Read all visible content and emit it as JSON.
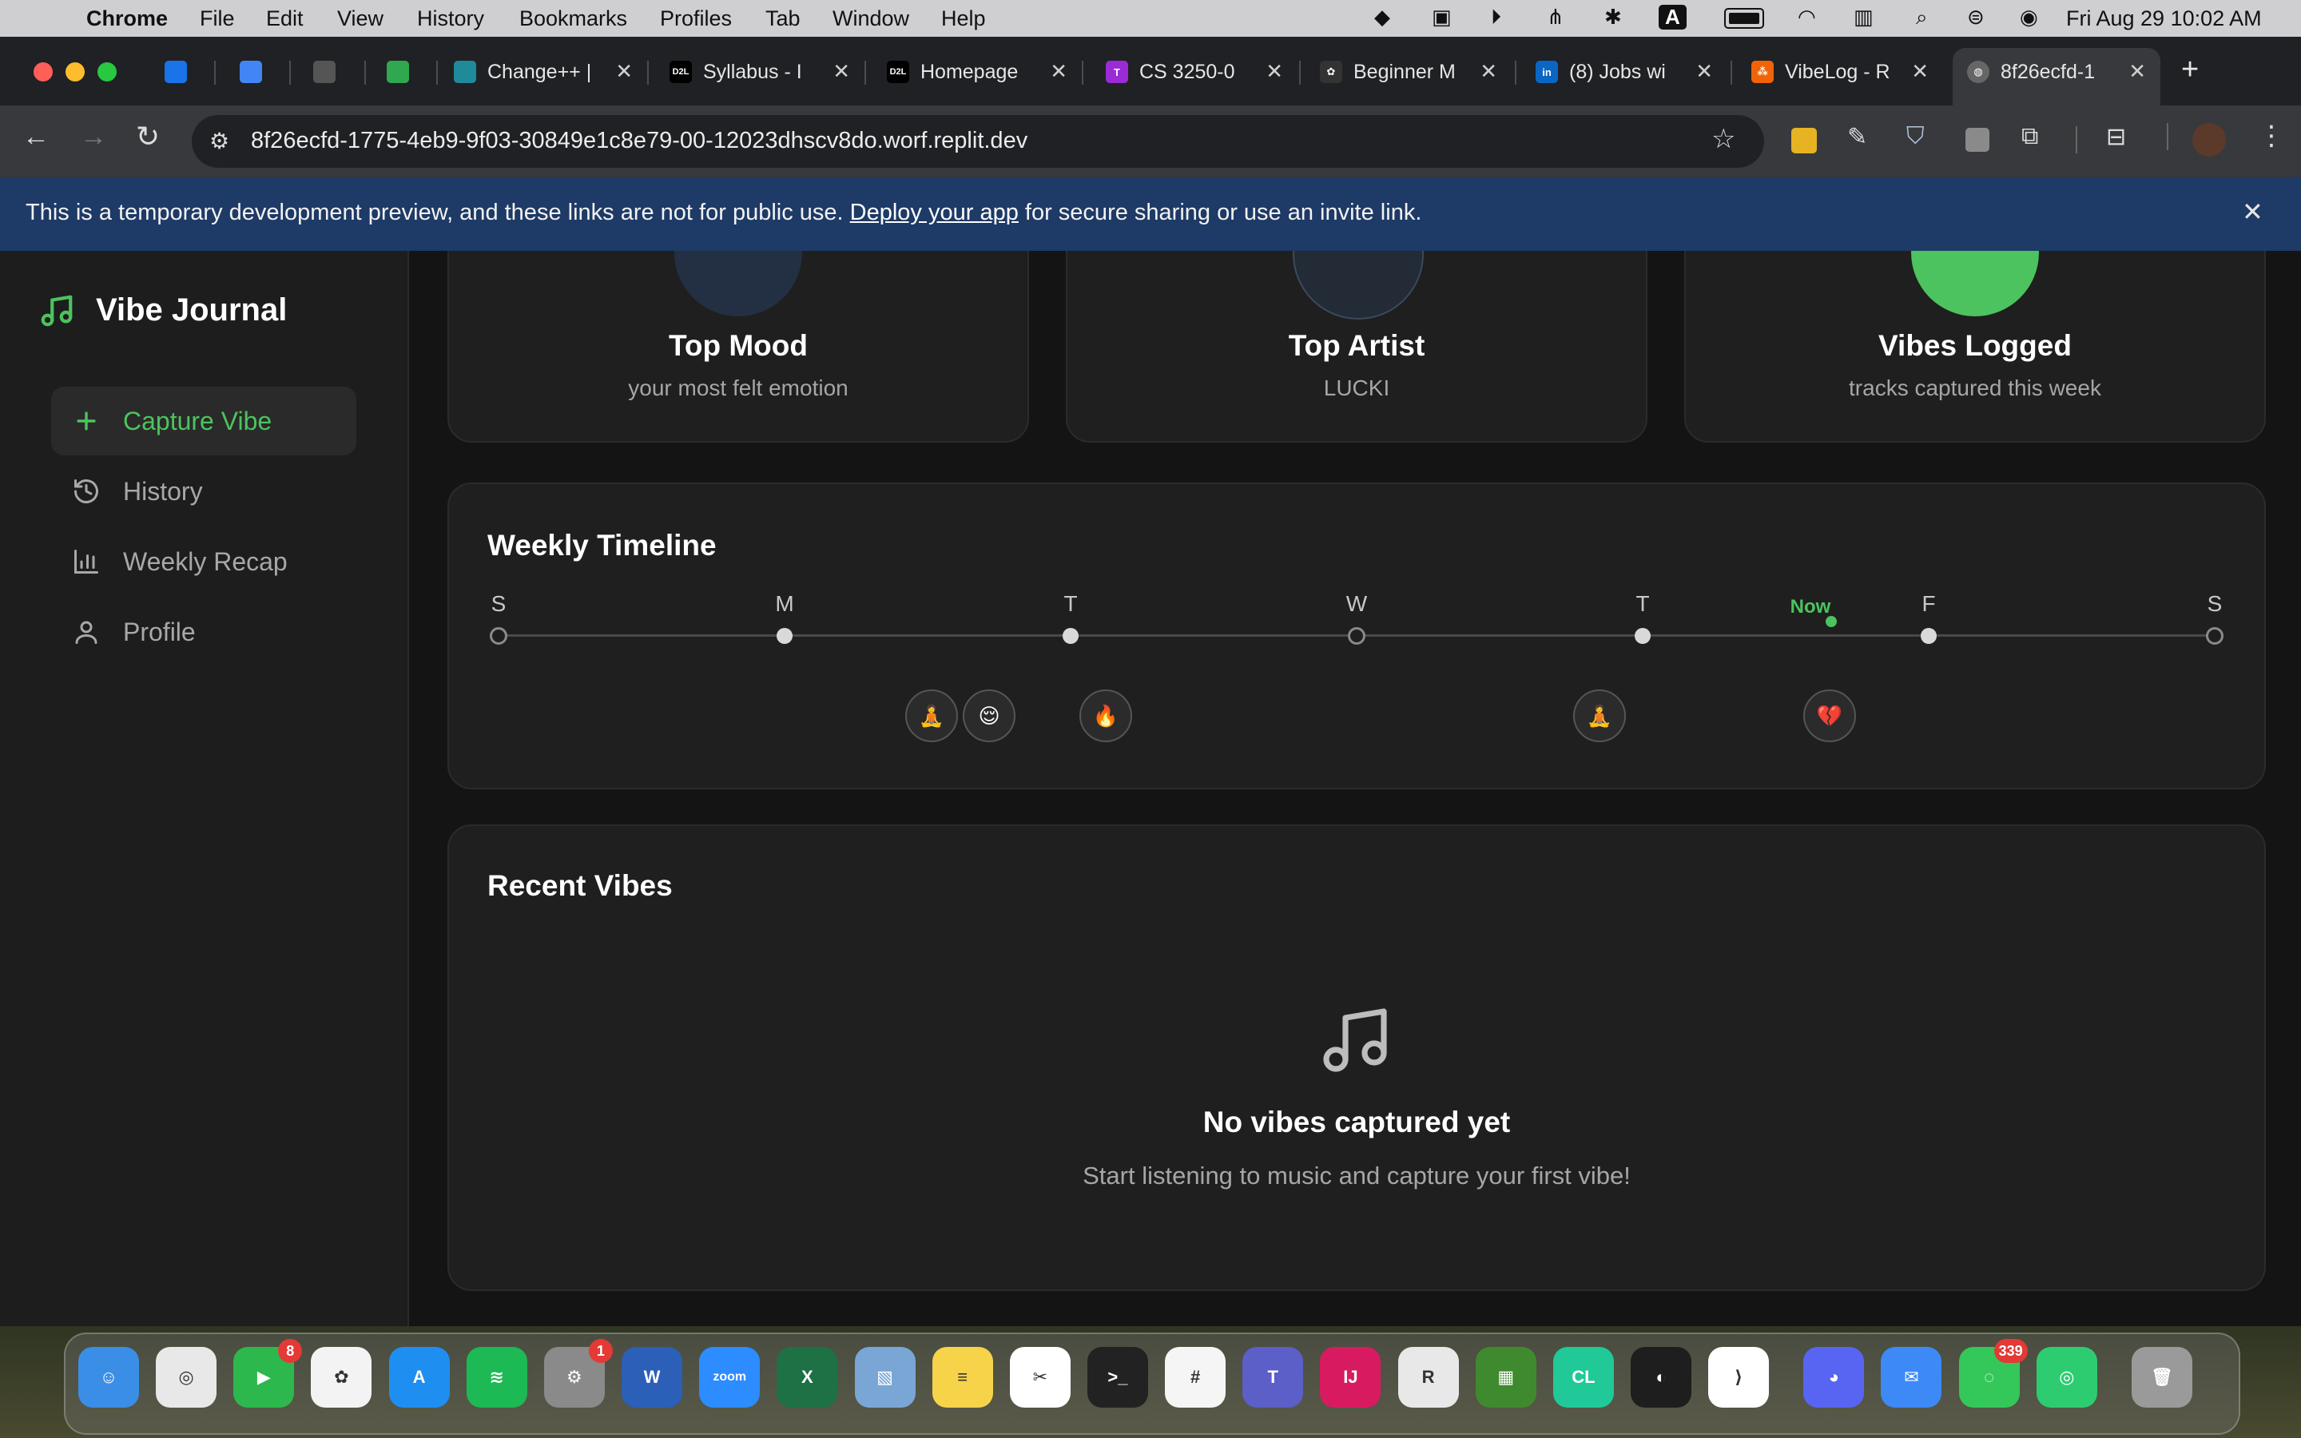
{
  "menubar": {
    "app_name": "Chrome",
    "items": [
      "File",
      "Edit",
      "View",
      "History",
      "Bookmarks",
      "Profiles",
      "Tab",
      "Window",
      "Help"
    ],
    "clock": "Fri Aug 29  10:02 AM"
  },
  "browser": {
    "tabs": [
      {
        "label": "",
        "icon": "outlook-icon",
        "color": "#1a73e8"
      },
      {
        "label": "",
        "icon": "calendar-icon",
        "color": "#4285f4"
      },
      {
        "label": "",
        "icon": "pen-icon",
        "color": "#555555"
      },
      {
        "label": "",
        "icon": "slash-icon",
        "color": "#2fa84f"
      },
      {
        "label": "Change++ |",
        "icon": "changepp-icon",
        "color": "#1f8a9a"
      },
      {
        "label": "Syllabus - I",
        "icon": "d2l-icon",
        "color": "#000000"
      },
      {
        "label": "Homepage",
        "icon": "d2l-icon",
        "color": "#000000"
      },
      {
        "label": "CS 3250-0",
        "icon": "t-icon",
        "color": "#9b2bd6"
      },
      {
        "label": "Beginner M",
        "icon": "openai-icon",
        "color": "#333333"
      },
      {
        "label": "(8) Jobs wi",
        "icon": "linkedin-icon",
        "color": "#0a66c2"
      },
      {
        "label": "VibeLog - R",
        "icon": "replit-icon",
        "color": "#f26207"
      },
      {
        "label": "8f26ecfd-1",
        "icon": "globe-icon",
        "color": "#666666"
      }
    ],
    "url": "8f26ecfd-1775-4eb9-9f03-30849e1c8e79-00-12023dhscv8do.worf.replit.dev"
  },
  "banner": {
    "text_before": "This is a temporary development preview, and these links are not for public use.",
    "link": "Deploy your app",
    "text_after": "for secure sharing or use an invite link."
  },
  "sidebar": {
    "brand": "Vibe Journal",
    "items": [
      {
        "label": "Capture Vibe",
        "icon": "plus-icon",
        "active": true
      },
      {
        "label": "History",
        "icon": "history-icon",
        "active": false
      },
      {
        "label": "Weekly Recap",
        "icon": "bar-chart-icon",
        "active": false
      },
      {
        "label": "Profile",
        "icon": "user-icon",
        "active": false
      }
    ]
  },
  "stats": [
    {
      "title": "Top Mood",
      "subtitle": "your most felt emotion"
    },
    {
      "title": "Top Artist",
      "subtitle": "LUCKI"
    },
    {
      "title": "Vibes Logged",
      "subtitle": "tracks captured this week"
    }
  ],
  "timeline": {
    "title": "Weekly Timeline",
    "days": [
      {
        "label": "S",
        "logged": false
      },
      {
        "label": "M",
        "logged": true
      },
      {
        "label": "T",
        "logged": true
      },
      {
        "label": "W",
        "logged": false
      },
      {
        "label": "T",
        "logged": true
      },
      {
        "label": "F",
        "logged": true
      },
      {
        "label": "S",
        "logged": false
      }
    ],
    "now_label": "Now",
    "entries": [
      "🧘",
      "😌",
      "🔥",
      "🧘",
      "💔"
    ]
  },
  "recent": {
    "title": "Recent Vibes",
    "empty_title": "No vibes captured yet",
    "empty_subtitle": "Start listening to music and capture your first vibe!"
  },
  "colors": {
    "accent": "#4cc35e",
    "banner": "#1e3a66"
  },
  "dock": {
    "apps": [
      {
        "name": "Finder",
        "icon": "finder-icon",
        "color": "#3b8ee6"
      },
      {
        "name": "Chrome",
        "icon": "chrome-icon",
        "color": "#e8e8e8"
      },
      {
        "name": "FaceTime",
        "icon": "facetime-icon",
        "color": "#2db84d",
        "badge": "8"
      },
      {
        "name": "Photos",
        "icon": "photos-icon",
        "color": "#f3f3f3"
      },
      {
        "name": "App Store",
        "icon": "appstore-icon",
        "color": "#1f8ef1"
      },
      {
        "name": "Spotify",
        "icon": "spotify-icon",
        "color": "#1db954"
      },
      {
        "name": "System Settings",
        "icon": "settings-icon",
        "color": "#8a8a8a",
        "badge": "1"
      },
      {
        "name": "Word",
        "icon": "word-icon",
        "color": "#2b5fb8"
      },
      {
        "name": "Zoom",
        "icon": "zoom-icon",
        "color": "#2d8cff"
      },
      {
        "name": "Excel",
        "icon": "excel-icon",
        "color": "#1e7145"
      },
      {
        "name": "Preview",
        "icon": "preview-icon",
        "color": "#7aa6d6"
      },
      {
        "name": "Notes",
        "icon": "notes-icon",
        "color": "#f7d34a"
      },
      {
        "name": "CapCut",
        "icon": "capcut-icon",
        "color": "#ffffff"
      },
      {
        "name": "Terminal",
        "icon": "terminal-icon",
        "color": "#222222"
      },
      {
        "name": "Slack",
        "icon": "slack-icon",
        "color": "#f5f5f5"
      },
      {
        "name": "Teams",
        "icon": "teams-icon",
        "color": "#5b5fc7"
      },
      {
        "name": "IntelliJ",
        "icon": "intellij-icon",
        "color": "#d81b60"
      },
      {
        "name": "R",
        "icon": "r-icon",
        "color": "#e8e8e8"
      },
      {
        "name": "Minecraft",
        "icon": "minecraft-icon",
        "color": "#3f8a2f"
      },
      {
        "name": "CLion",
        "icon": "clion-icon",
        "color": "#20c997"
      },
      {
        "name": "Figma",
        "icon": "figma-icon",
        "color": "#1e1e1e"
      },
      {
        "name": "VS Code",
        "icon": "vscode-icon",
        "color": "#ffffff"
      },
      {
        "name": "Discord",
        "icon": "discord-icon",
        "color": "#5865f2"
      },
      {
        "name": "Mail",
        "icon": "mail-icon",
        "color": "#3d8af7"
      },
      {
        "name": "Messages",
        "icon": "messages-icon",
        "color": "#34c759",
        "badge": "339"
      },
      {
        "name": "Find My",
        "icon": "findmy-icon",
        "color": "#2ecc71"
      },
      {
        "name": "Trash",
        "icon": "trash-icon",
        "color": "#9a9a9a"
      }
    ]
  }
}
